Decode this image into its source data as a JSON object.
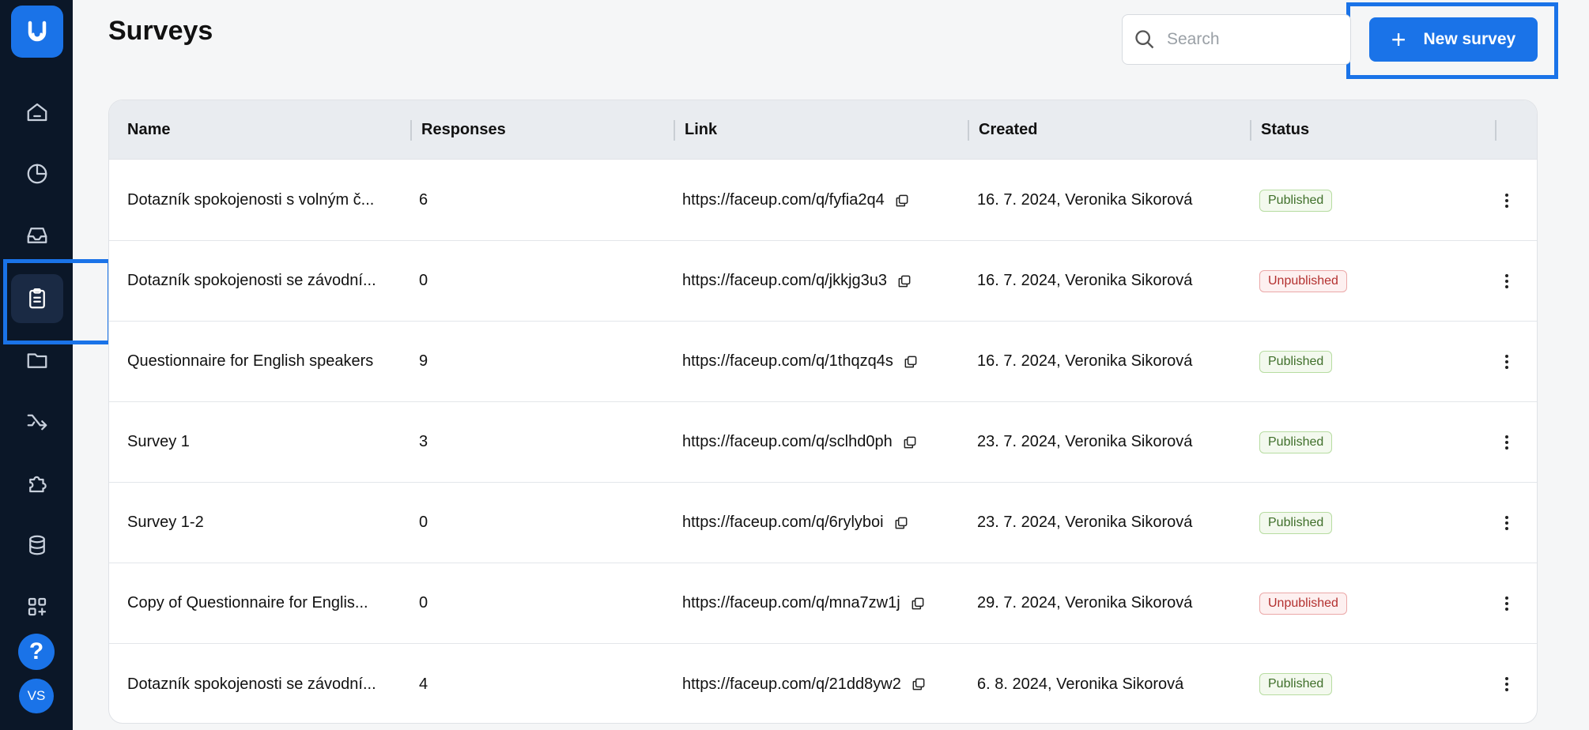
{
  "sidebar": {
    "items": [
      {
        "name": "home-icon"
      },
      {
        "name": "pie-chart-icon"
      },
      {
        "name": "inbox-icon"
      },
      {
        "name": "clipboard-icon",
        "active": true
      },
      {
        "name": "folder-icon"
      },
      {
        "name": "shuffle-icon"
      },
      {
        "name": "puzzle-icon"
      },
      {
        "name": "database-icon"
      },
      {
        "name": "apps-add-icon"
      }
    ],
    "help_label": "?",
    "avatar_initials": "VS"
  },
  "header": {
    "title": "Surveys",
    "search_placeholder": "Search",
    "new_survey_label": "New survey"
  },
  "table": {
    "columns": [
      "Name",
      "Responses",
      "Link",
      "Created",
      "Status"
    ],
    "rows": [
      {
        "name": "Dotazník spokojenosti s volným č...",
        "responses": "6",
        "link": "https://faceup.com/q/fyfia2q4",
        "created": "16. 7. 2024, Veronika Sikorová",
        "status": "Published"
      },
      {
        "name": "Dotazník spokojenosti se závodní...",
        "responses": "0",
        "link": "https://faceup.com/q/jkkjg3u3",
        "created": "16. 7. 2024, Veronika Sikorová",
        "status": "Unpublished"
      },
      {
        "name": "Questionnaire for English speakers",
        "responses": "9",
        "link": "https://faceup.com/q/1thqzq4s",
        "created": "16. 7. 2024, Veronika Sikorová",
        "status": "Published"
      },
      {
        "name": "Survey 1",
        "responses": "3",
        "link": "https://faceup.com/q/sclhd0ph",
        "created": "23. 7. 2024, Veronika Sikorová",
        "status": "Published"
      },
      {
        "name": "Survey 1-2",
        "responses": "0",
        "link": "https://faceup.com/q/6rylyboi",
        "created": "23. 7. 2024, Veronika Sikorová",
        "status": "Published"
      },
      {
        "name": "Copy of Questionnaire for Englis...",
        "responses": "0",
        "link": "https://faceup.com/q/mna7zw1j",
        "created": "29. 7. 2024, Veronika Sikorová",
        "status": "Unpublished"
      },
      {
        "name": "Dotazník spokojenosti se závodní...",
        "responses": "4",
        "link": "https://faceup.com/q/21dd8yw2",
        "created": "6. 8. 2024, Veronika Sikorová",
        "status": "Published"
      }
    ]
  },
  "colors": {
    "accent": "#1a73e8",
    "sidebar": "#0b1728",
    "published": "#3f6f2a",
    "unpublished": "#b3302f"
  }
}
